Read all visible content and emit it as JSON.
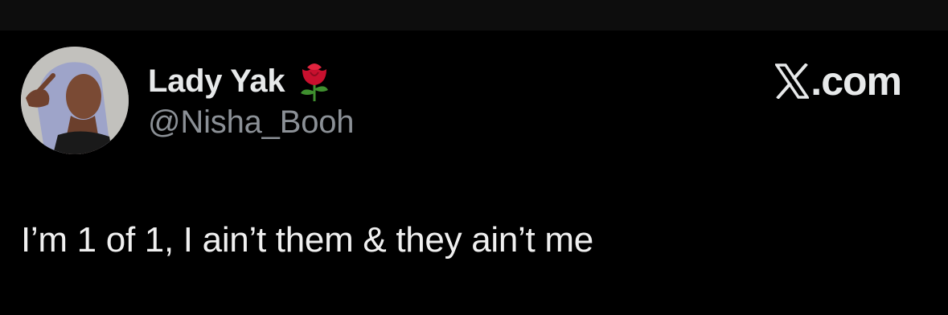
{
  "tweet": {
    "author": {
      "display_name": "Lady Yak",
      "handle": "@Nisha_Booh",
      "name_emoji": "rose-icon",
      "avatar": "avatar"
    },
    "source_label": ".com",
    "source_icon": "x-logo-icon",
    "text": "I’m 1 of 1, I ain’t them & they ain’t me"
  },
  "colors": {
    "background": "#000000",
    "top_strip": "#0d0d0d",
    "primary_text": "#e7e9ea",
    "secondary_text": "#8b9096",
    "rose_red": "#c8102e",
    "rose_leaf": "#3f8f2f"
  }
}
